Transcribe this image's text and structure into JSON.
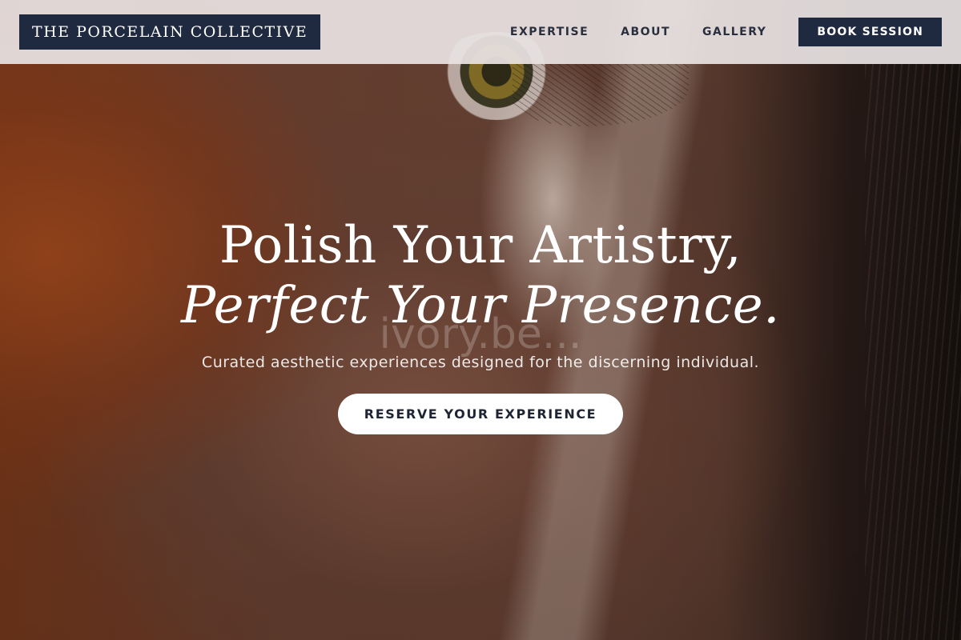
{
  "header": {
    "logo_text": "THE PORCELAIN COLLECTIVE",
    "nav": [
      "EXPERTISE",
      "ABOUT",
      "GALLERY"
    ],
    "cta_label": "BOOK SESSION"
  },
  "hero": {
    "headline_line1": "Polish Your Artistry,",
    "headline_line2": "Perfect Your Presence.",
    "subtitle": "Curated aesthetic experiences designed for the discerning individual.",
    "cta_label": "RESERVE YOUR EXPERIENCE",
    "watermark": "ivory.be..."
  },
  "colors": {
    "brand_navy": "#1f2a40",
    "header_bg": "#e8e2e2",
    "cta_bg": "#ffffff"
  }
}
